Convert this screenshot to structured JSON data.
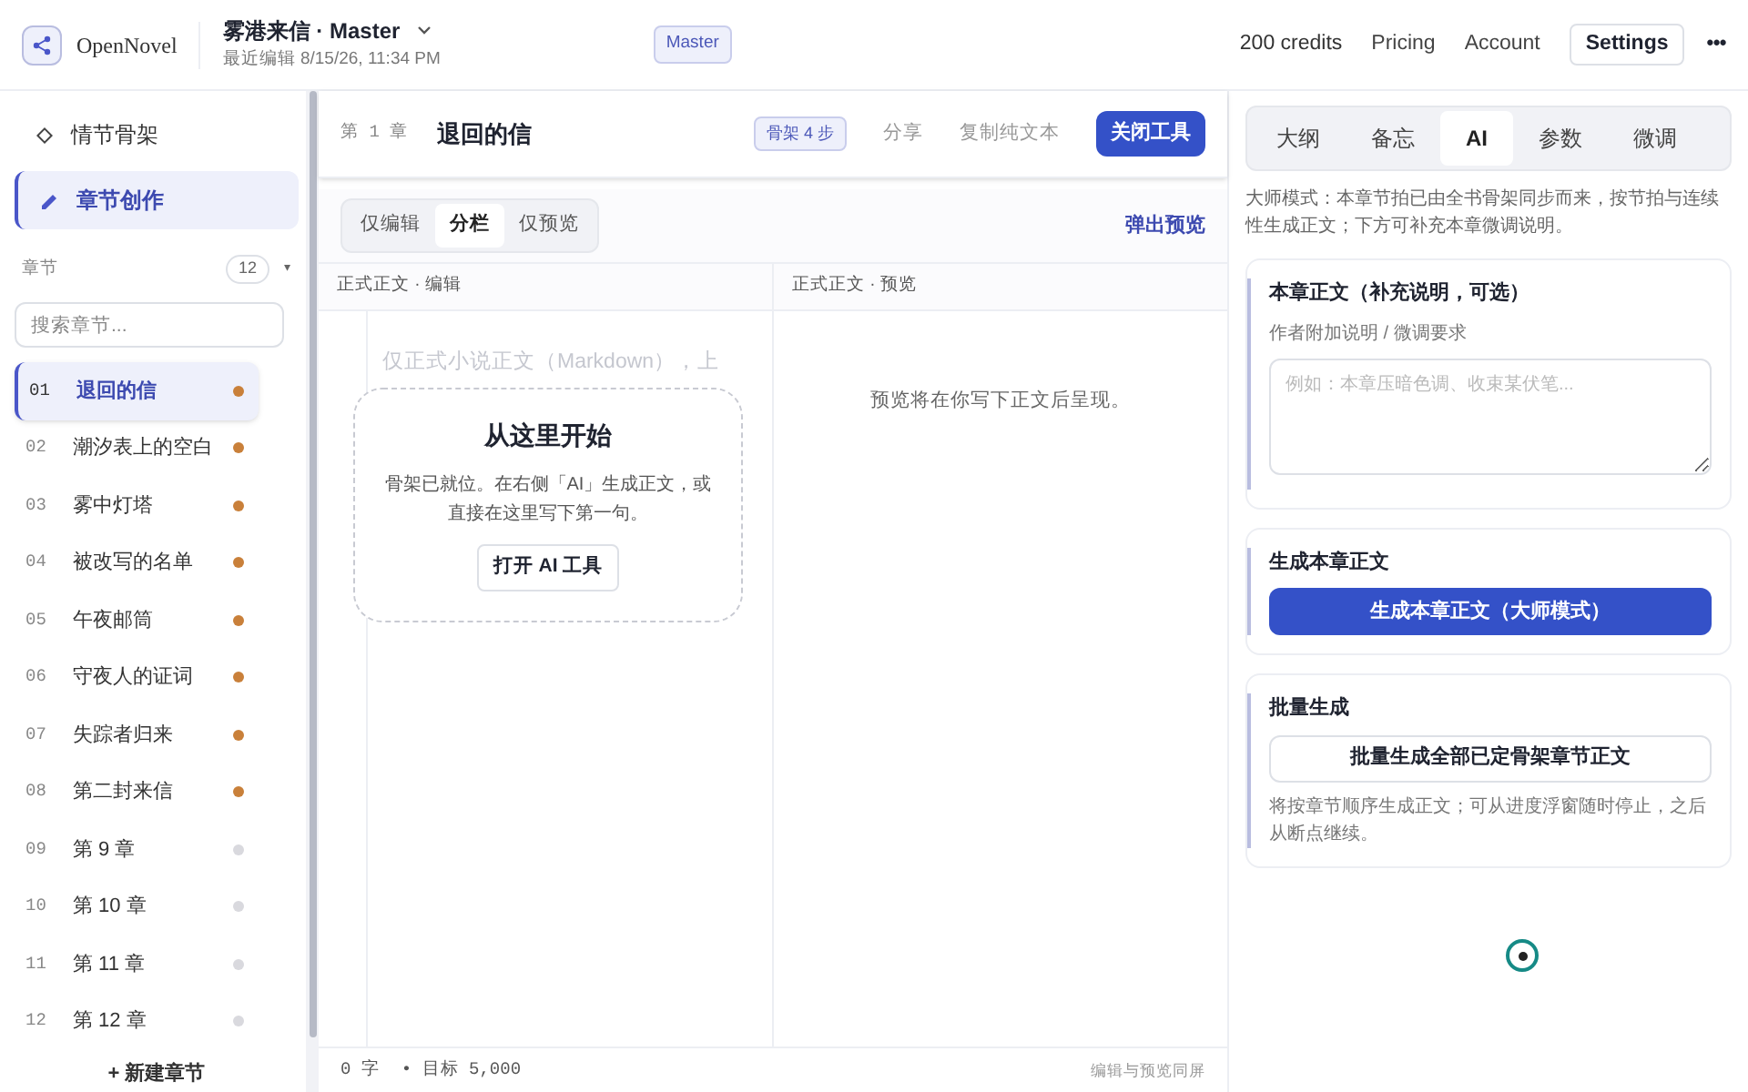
{
  "header": {
    "brand": "OpenNovel",
    "title": "雾港来信 · Master",
    "subtitle": "最近编辑 8/15/26, 11:34 PM",
    "mode_badge": "Master",
    "credits": "200 credits",
    "links": [
      "Pricing",
      "Account"
    ],
    "settings": "Settings",
    "more": "•••"
  },
  "sidebar": {
    "nav": [
      {
        "label": "情节骨架",
        "selected": false,
        "kind": "diamond"
      },
      {
        "label": "章节创作",
        "selected": true,
        "kind": "pen"
      }
    ],
    "chapters_label": "章节",
    "chapters_count": "12",
    "collapse": "▾",
    "search": {
      "placeholder": "搜索章节..."
    },
    "chapters": [
      {
        "num": "01",
        "title": "退回的信",
        "selected": true,
        "color": "#c9803a"
      },
      {
        "num": "02",
        "title": "潮汐表上的空白",
        "selected": false,
        "color": "#c9803a"
      },
      {
        "num": "03",
        "title": "雾中灯塔",
        "selected": false,
        "color": "#c9803a"
      },
      {
        "num": "04",
        "title": "被改写的名单",
        "selected": false,
        "color": "#c9803a"
      },
      {
        "num": "05",
        "title": "午夜邮筒",
        "selected": false,
        "color": "#c9803a"
      },
      {
        "num": "06",
        "title": "守夜人的证词",
        "selected": false,
        "color": "#c9803a"
      },
      {
        "num": "07",
        "title": "失踪者归来",
        "selected": false,
        "color": "#c9803a"
      },
      {
        "num": "08",
        "title": "第二封来信",
        "selected": false,
        "color": "#c9803a"
      },
      {
        "num": "09",
        "title": "第 9 章",
        "selected": false,
        "color": "#d9d9de"
      },
      {
        "num": "10",
        "title": "第 10 章",
        "selected": false,
        "color": "#d9d9de"
      },
      {
        "num": "11",
        "title": "第 11 章",
        "selected": false,
        "color": "#d9d9de"
      },
      {
        "num": "12",
        "title": "第 12 章",
        "selected": false,
        "color": "#d9d9de"
      }
    ],
    "new_chapter": "+ 新建章节"
  },
  "editor": {
    "chapter_no": "第 1 章",
    "chapter_title": "退回的信",
    "skeleton_badge": "骨架 4 步",
    "actions": [
      "分享",
      "复制纯文本"
    ],
    "close_tools": "关闭工具",
    "view_tabs": [
      {
        "label": "仅编辑",
        "selected": false
      },
      {
        "label": "分栏",
        "selected": true
      },
      {
        "label": "仅预览",
        "selected": false
      }
    ],
    "popout": "弹出预览",
    "edit_header": "正式正文 · 编辑",
    "preview_header": "正式正文 · 预览",
    "placeholder": "仅正式小说正文（Markdown），上",
    "start_card": {
      "title": "从这里开始",
      "text": "骨架已就位。在右侧「AI」生成正文，或直接在这里写下第一句。",
      "button": "打开 AI 工具"
    },
    "preview_empty": "预览将在你写下正文后呈现。",
    "word_count": "0 字",
    "target": "• 目标 5,000",
    "footer_note": "编辑与预览同屏"
  },
  "panel": {
    "tabs": [
      {
        "label": "大纲",
        "selected": false
      },
      {
        "label": "备忘",
        "selected": false
      },
      {
        "label": "AI",
        "selected": true
      },
      {
        "label": "参数",
        "selected": false
      },
      {
        "label": "微调",
        "selected": false
      }
    ],
    "intro": "大师模式：本章节拍已由全书骨架同步而来，按节拍与连续性生成正文；下方可补充本章微调说明。",
    "sections": [
      {
        "kind": "textarea",
        "title": "本章正文（补充说明，可选）",
        "label": "作者附加说明 / 微调要求",
        "placeholder": "例如：本章压暗色调、收束某伏笔..."
      },
      {
        "kind": "primary",
        "title": "生成本章正文",
        "button": "生成本章正文（大师模式）"
      },
      {
        "kind": "secondary",
        "title": "批量生成",
        "button": "批量生成全部已定骨架章节正文",
        "note": "将按章节顺序生成正文；可从进度浮窗随时停止，之后从断点继续。"
      }
    ]
  }
}
